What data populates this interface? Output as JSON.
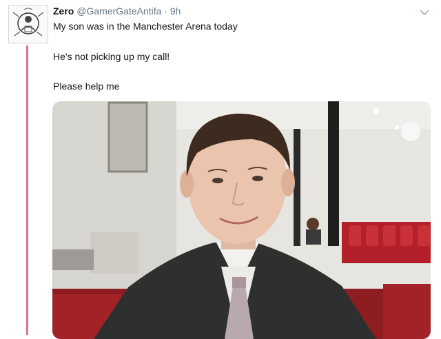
{
  "tweet": {
    "display_name": "Zero",
    "handle": "@GamerGateAntifa",
    "separator": "·",
    "time": "9h",
    "lines": [
      "My son was in the Manchester Arena today",
      "He's not picking up my call!",
      "Please help me"
    ]
  },
  "icons": {
    "avatar": "avatar-icon",
    "menu": "chevron-down-icon"
  },
  "colors": {
    "thread_line": "#e0718e",
    "text": "#14171a",
    "muted": "#657786"
  },
  "media": {
    "description_kind": "photo"
  }
}
